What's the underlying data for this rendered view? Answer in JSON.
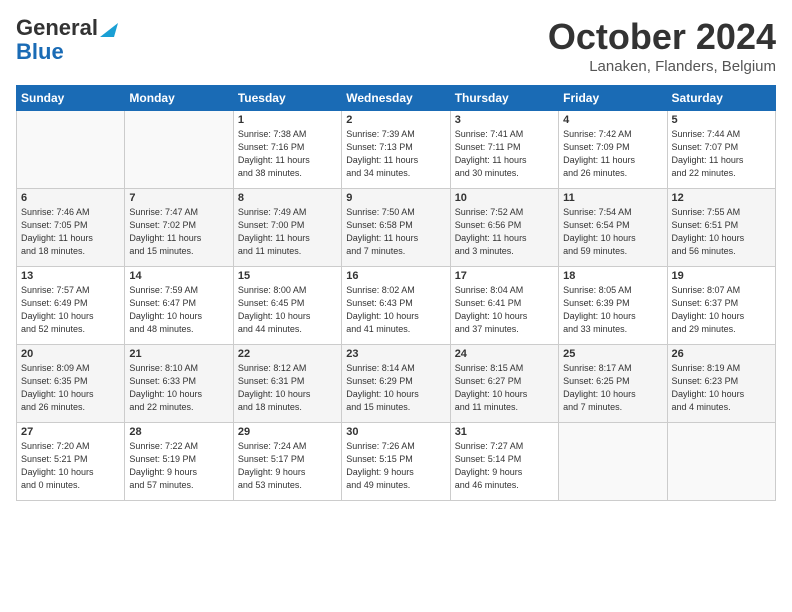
{
  "header": {
    "logo_line1": "General",
    "logo_line2": "Blue",
    "title": "October 2024",
    "location": "Lanaken, Flanders, Belgium"
  },
  "weekdays": [
    "Sunday",
    "Monday",
    "Tuesday",
    "Wednesday",
    "Thursday",
    "Friday",
    "Saturday"
  ],
  "weeks": [
    [
      {
        "day": "",
        "info": ""
      },
      {
        "day": "",
        "info": ""
      },
      {
        "day": "1",
        "info": "Sunrise: 7:38 AM\nSunset: 7:16 PM\nDaylight: 11 hours\nand 38 minutes."
      },
      {
        "day": "2",
        "info": "Sunrise: 7:39 AM\nSunset: 7:13 PM\nDaylight: 11 hours\nand 34 minutes."
      },
      {
        "day": "3",
        "info": "Sunrise: 7:41 AM\nSunset: 7:11 PM\nDaylight: 11 hours\nand 30 minutes."
      },
      {
        "day": "4",
        "info": "Sunrise: 7:42 AM\nSunset: 7:09 PM\nDaylight: 11 hours\nand 26 minutes."
      },
      {
        "day": "5",
        "info": "Sunrise: 7:44 AM\nSunset: 7:07 PM\nDaylight: 11 hours\nand 22 minutes."
      }
    ],
    [
      {
        "day": "6",
        "info": "Sunrise: 7:46 AM\nSunset: 7:05 PM\nDaylight: 11 hours\nand 18 minutes."
      },
      {
        "day": "7",
        "info": "Sunrise: 7:47 AM\nSunset: 7:02 PM\nDaylight: 11 hours\nand 15 minutes."
      },
      {
        "day": "8",
        "info": "Sunrise: 7:49 AM\nSunset: 7:00 PM\nDaylight: 11 hours\nand 11 minutes."
      },
      {
        "day": "9",
        "info": "Sunrise: 7:50 AM\nSunset: 6:58 PM\nDaylight: 11 hours\nand 7 minutes."
      },
      {
        "day": "10",
        "info": "Sunrise: 7:52 AM\nSunset: 6:56 PM\nDaylight: 11 hours\nand 3 minutes."
      },
      {
        "day": "11",
        "info": "Sunrise: 7:54 AM\nSunset: 6:54 PM\nDaylight: 10 hours\nand 59 minutes."
      },
      {
        "day": "12",
        "info": "Sunrise: 7:55 AM\nSunset: 6:51 PM\nDaylight: 10 hours\nand 56 minutes."
      }
    ],
    [
      {
        "day": "13",
        "info": "Sunrise: 7:57 AM\nSunset: 6:49 PM\nDaylight: 10 hours\nand 52 minutes."
      },
      {
        "day": "14",
        "info": "Sunrise: 7:59 AM\nSunset: 6:47 PM\nDaylight: 10 hours\nand 48 minutes."
      },
      {
        "day": "15",
        "info": "Sunrise: 8:00 AM\nSunset: 6:45 PM\nDaylight: 10 hours\nand 44 minutes."
      },
      {
        "day": "16",
        "info": "Sunrise: 8:02 AM\nSunset: 6:43 PM\nDaylight: 10 hours\nand 41 minutes."
      },
      {
        "day": "17",
        "info": "Sunrise: 8:04 AM\nSunset: 6:41 PM\nDaylight: 10 hours\nand 37 minutes."
      },
      {
        "day": "18",
        "info": "Sunrise: 8:05 AM\nSunset: 6:39 PM\nDaylight: 10 hours\nand 33 minutes."
      },
      {
        "day": "19",
        "info": "Sunrise: 8:07 AM\nSunset: 6:37 PM\nDaylight: 10 hours\nand 29 minutes."
      }
    ],
    [
      {
        "day": "20",
        "info": "Sunrise: 8:09 AM\nSunset: 6:35 PM\nDaylight: 10 hours\nand 26 minutes."
      },
      {
        "day": "21",
        "info": "Sunrise: 8:10 AM\nSunset: 6:33 PM\nDaylight: 10 hours\nand 22 minutes."
      },
      {
        "day": "22",
        "info": "Sunrise: 8:12 AM\nSunset: 6:31 PM\nDaylight: 10 hours\nand 18 minutes."
      },
      {
        "day": "23",
        "info": "Sunrise: 8:14 AM\nSunset: 6:29 PM\nDaylight: 10 hours\nand 15 minutes."
      },
      {
        "day": "24",
        "info": "Sunrise: 8:15 AM\nSunset: 6:27 PM\nDaylight: 10 hours\nand 11 minutes."
      },
      {
        "day": "25",
        "info": "Sunrise: 8:17 AM\nSunset: 6:25 PM\nDaylight: 10 hours\nand 7 minutes."
      },
      {
        "day": "26",
        "info": "Sunrise: 8:19 AM\nSunset: 6:23 PM\nDaylight: 10 hours\nand 4 minutes."
      }
    ],
    [
      {
        "day": "27",
        "info": "Sunrise: 7:20 AM\nSunset: 5:21 PM\nDaylight: 10 hours\nand 0 minutes."
      },
      {
        "day": "28",
        "info": "Sunrise: 7:22 AM\nSunset: 5:19 PM\nDaylight: 9 hours\nand 57 minutes."
      },
      {
        "day": "29",
        "info": "Sunrise: 7:24 AM\nSunset: 5:17 PM\nDaylight: 9 hours\nand 53 minutes."
      },
      {
        "day": "30",
        "info": "Sunrise: 7:26 AM\nSunset: 5:15 PM\nDaylight: 9 hours\nand 49 minutes."
      },
      {
        "day": "31",
        "info": "Sunrise: 7:27 AM\nSunset: 5:14 PM\nDaylight: 9 hours\nand 46 minutes."
      },
      {
        "day": "",
        "info": ""
      },
      {
        "day": "",
        "info": ""
      }
    ]
  ]
}
